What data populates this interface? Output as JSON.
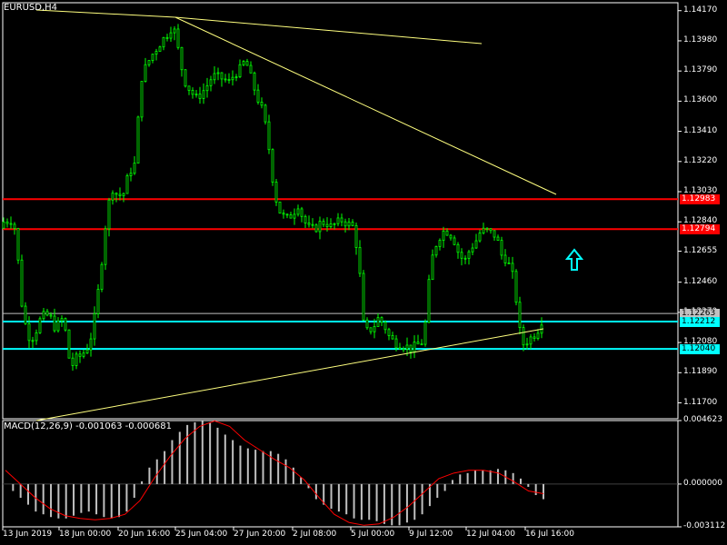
{
  "chart_title": "EURUSD,H4",
  "macd_title": "MACD(12,26,9) -0.001063 -0.000681",
  "price_axis": [
    "1.14170",
    "1.13980",
    "1.13790",
    "1.13600",
    "1.13410",
    "1.13220",
    "1.13030",
    "1.12840",
    "1.12655",
    "1.12460",
    "1.12270",
    "1.12080",
    "1.11890",
    "1.11700"
  ],
  "macd_axis": [
    "0.004623",
    "0.000000",
    "-0.003112"
  ],
  "time_axis": [
    "13 Jun 2019",
    "18 Jun 00:00",
    "20 Jun 16:00",
    "25 Jun 04:00",
    "27 Jun 20:00",
    "2 Jul 08:00",
    "5 Jul 00:00",
    "9 Jul 12:00",
    "12 Jul 04:00",
    "16 Jul 16:00"
  ],
  "price_tags": [
    {
      "text": "1.12983",
      "bg": "#ff0000",
      "fg": "#ffffff"
    },
    {
      "text": "1.12794",
      "bg": "#ff0000",
      "fg": "#ffffff"
    },
    {
      "text": "1.12263",
      "bg": "#c0c0c0",
      "fg": "#000000"
    },
    {
      "text": "1.12212",
      "bg": "#00ffff",
      "fg": "#000000"
    },
    {
      "text": "1.12040",
      "bg": "#00ffff",
      "fg": "#000000"
    }
  ],
  "colors": {
    "candle": "#00ff00",
    "support_line": "#00ffff",
    "resistance_line": "#ff0000",
    "trend_line": "#ffff7f",
    "macd_hist": "#c0c0c0",
    "macd_signal": "#ff0000",
    "axis": "#ffffff"
  },
  "chart_data": {
    "type": "candlestick",
    "symbol": "EURUSD",
    "timeframe": "H4",
    "horizontal_levels": [
      1.12983,
      1.12794,
      1.12212,
      1.1204
    ],
    "current_price": 1.12263,
    "ylim": [
      1.116,
      1.1422
    ],
    "trend_lines": [
      {
        "from": [
          "13 Jun 2019 start",
          1.1421
        ],
        "to": [
          "25 Jun 04:00",
          1.1412
        ]
      },
      {
        "from": [
          "25 Jun 04:00",
          1.1412
        ],
        "to": [
          "12 Jul 16:00",
          1.1392
        ]
      },
      {
        "from": [
          "25 Jun 04:00",
          1.1414
        ],
        "to": [
          "16 Jul 16:00",
          1.1296
        ]
      },
      {
        "from": [
          "13 Jun 2019",
          1.1158
        ],
        "to": [
          "16 Jul 16:00",
          1.1208
        ]
      }
    ],
    "price_series": [
      [
        0,
        1.128
      ],
      [
        4,
        1.1284
      ],
      [
        12,
        1.1285
      ],
      [
        18,
        1.1278
      ],
      [
        22,
        1.124
      ],
      [
        26,
        1.1225
      ],
      [
        30,
        1.1214
      ],
      [
        34,
        1.121
      ],
      [
        38,
        1.1213
      ],
      [
        44,
        1.1222
      ],
      [
        50,
        1.1226
      ],
      [
        56,
        1.1223
      ],
      [
        60,
        1.1218
      ],
      [
        66,
        1.122
      ],
      [
        70,
        1.1225
      ],
      [
        74,
        1.1205
      ],
      [
        78,
        1.1192
      ],
      [
        84,
        1.1198
      ],
      [
        90,
        1.12
      ],
      [
        96,
        1.1205
      ],
      [
        102,
        1.1215
      ],
      [
        108,
        1.124
      ],
      [
        112,
        1.126
      ],
      [
        118,
        1.1292
      ],
      [
        124,
        1.1305
      ],
      [
        130,
        1.13
      ],
      [
        136,
        1.1302
      ],
      [
        142,
        1.1315
      ],
      [
        148,
        1.132
      ],
      [
        152,
        1.1348
      ],
      [
        156,
        1.1375
      ],
      [
        160,
        1.1381
      ],
      [
        166,
        1.1388
      ],
      [
        172,
        1.1393
      ],
      [
        178,
        1.1398
      ],
      [
        184,
        1.1402
      ],
      [
        190,
        1.1408
      ],
      [
        194,
        1.14
      ],
      [
        198,
        1.1385
      ],
      [
        204,
        1.1372
      ],
      [
        210,
        1.1366
      ],
      [
        216,
        1.1362
      ],
      [
        222,
        1.1365
      ],
      [
        228,
        1.137
      ],
      [
        234,
        1.1376
      ],
      [
        240,
        1.1375
      ],
      [
        246,
        1.1374
      ],
      [
        252,
        1.1372
      ],
      [
        258,
        1.1377
      ],
      [
        264,
        1.138
      ],
      [
        270,
        1.1386
      ],
      [
        276,
        1.1375
      ],
      [
        282,
        1.1364
      ],
      [
        288,
        1.1355
      ],
      [
        294,
        1.134
      ],
      [
        298,
        1.132
      ],
      [
        302,
        1.1303
      ],
      [
        306,
        1.1293
      ],
      [
        310,
        1.1288
      ],
      [
        316,
        1.1286
      ],
      [
        322,
        1.1289
      ],
      [
        328,
        1.1295
      ],
      [
        334,
        1.1285
      ],
      [
        340,
        1.128
      ],
      [
        346,
        1.1279
      ],
      [
        352,
        1.1283
      ],
      [
        358,
        1.1284
      ],
      [
        364,
        1.1281
      ],
      [
        370,
        1.1283
      ],
      [
        376,
        1.1285
      ],
      [
        382,
        1.1283
      ],
      [
        388,
        1.1281
      ],
      [
        392,
        1.127
      ],
      [
        396,
        1.125
      ],
      [
        400,
        1.122
      ],
      [
        404,
        1.1215
      ],
      [
        410,
        1.1217
      ],
      [
        416,
        1.1223
      ],
      [
        422,
        1.122
      ],
      [
        428,
        1.1212
      ],
      [
        434,
        1.1208
      ],
      [
        440,
        1.1207
      ],
      [
        446,
        1.1206
      ],
      [
        452,
        1.1204
      ],
      [
        458,
        1.1206
      ],
      [
        464,
        1.1208
      ],
      [
        468,
        1.122
      ],
      [
        472,
        1.1245
      ],
      [
        476,
        1.1262
      ],
      [
        480,
        1.127
      ],
      [
        484,
        1.1275
      ],
      [
        488,
        1.1278
      ],
      [
        494,
        1.1278
      ],
      [
        500,
        1.1272
      ],
      [
        506,
        1.1262
      ],
      [
        512,
        1.126
      ],
      [
        518,
        1.1268
      ],
      [
        522,
        1.127
      ],
      [
        528,
        1.1277
      ],
      [
        534,
        1.1279
      ],
      [
        540,
        1.1277
      ],
      [
        546,
        1.1275
      ],
      [
        552,
        1.1263
      ],
      [
        558,
        1.126
      ],
      [
        564,
        1.125
      ],
      [
        568,
        1.1235
      ],
      [
        572,
        1.1215
      ],
      [
        576,
        1.1207
      ],
      [
        582,
        1.121
      ],
      [
        588,
        1.1213
      ],
      [
        594,
        1.1218
      ],
      [
        598,
        1.1226
      ]
    ],
    "macd_histogram": [
      0.0,
      -0.0005,
      -0.001,
      -0.0015,
      -0.002,
      -0.0022,
      -0.0024,
      -0.0025,
      -0.0025,
      -0.0023,
      -0.0021,
      -0.002,
      -0.0022,
      -0.0024,
      -0.0025,
      -0.0024,
      -0.002,
      -0.001,
      0.0002,
      0.0012,
      0.0018,
      0.0024,
      0.0032,
      0.0038,
      0.0043,
      0.0045,
      0.0046,
      0.0045,
      0.0041,
      0.0036,
      0.0032,
      0.0028,
      0.0026,
      0.0025,
      0.0024,
      0.0024,
      0.0022,
      0.0018,
      0.0012,
      0.0005,
      -0.0003,
      -0.0011,
      -0.0015,
      -0.0018,
      -0.002,
      -0.0022,
      -0.0025,
      -0.0026,
      -0.0026,
      -0.0027,
      -0.0029,
      -0.003,
      -0.003,
      -0.0028,
      -0.0026,
      -0.0022,
      -0.0016,
      -0.001,
      -0.0005,
      0.0003,
      0.0007,
      0.0008,
      0.001,
      0.001,
      0.001,
      0.0011,
      0.001,
      0.0008,
      0.0004,
      -0.0002,
      -0.0008,
      -0.0011
    ],
    "macd_signal": [
      0.001,
      0.0,
      -0.001,
      -0.0018,
      -0.0023,
      -0.0025,
      -0.0026,
      -0.0025,
      -0.0022,
      -0.0012,
      0.0005,
      0.002,
      0.0033,
      0.0042,
      0.0046,
      0.0042,
      0.0032,
      0.0025,
      0.0018,
      0.0012,
      0.0003,
      -0.001,
      -0.0022,
      -0.0028,
      -0.003,
      -0.0029,
      -0.0024,
      -0.0016,
      -0.0006,
      0.0004,
      0.0008,
      0.001,
      0.001,
      0.0008,
      0.0002,
      -0.0005,
      -0.0007
    ],
    "macd_ylim": [
      -0.003112,
      0.004623
    ]
  }
}
